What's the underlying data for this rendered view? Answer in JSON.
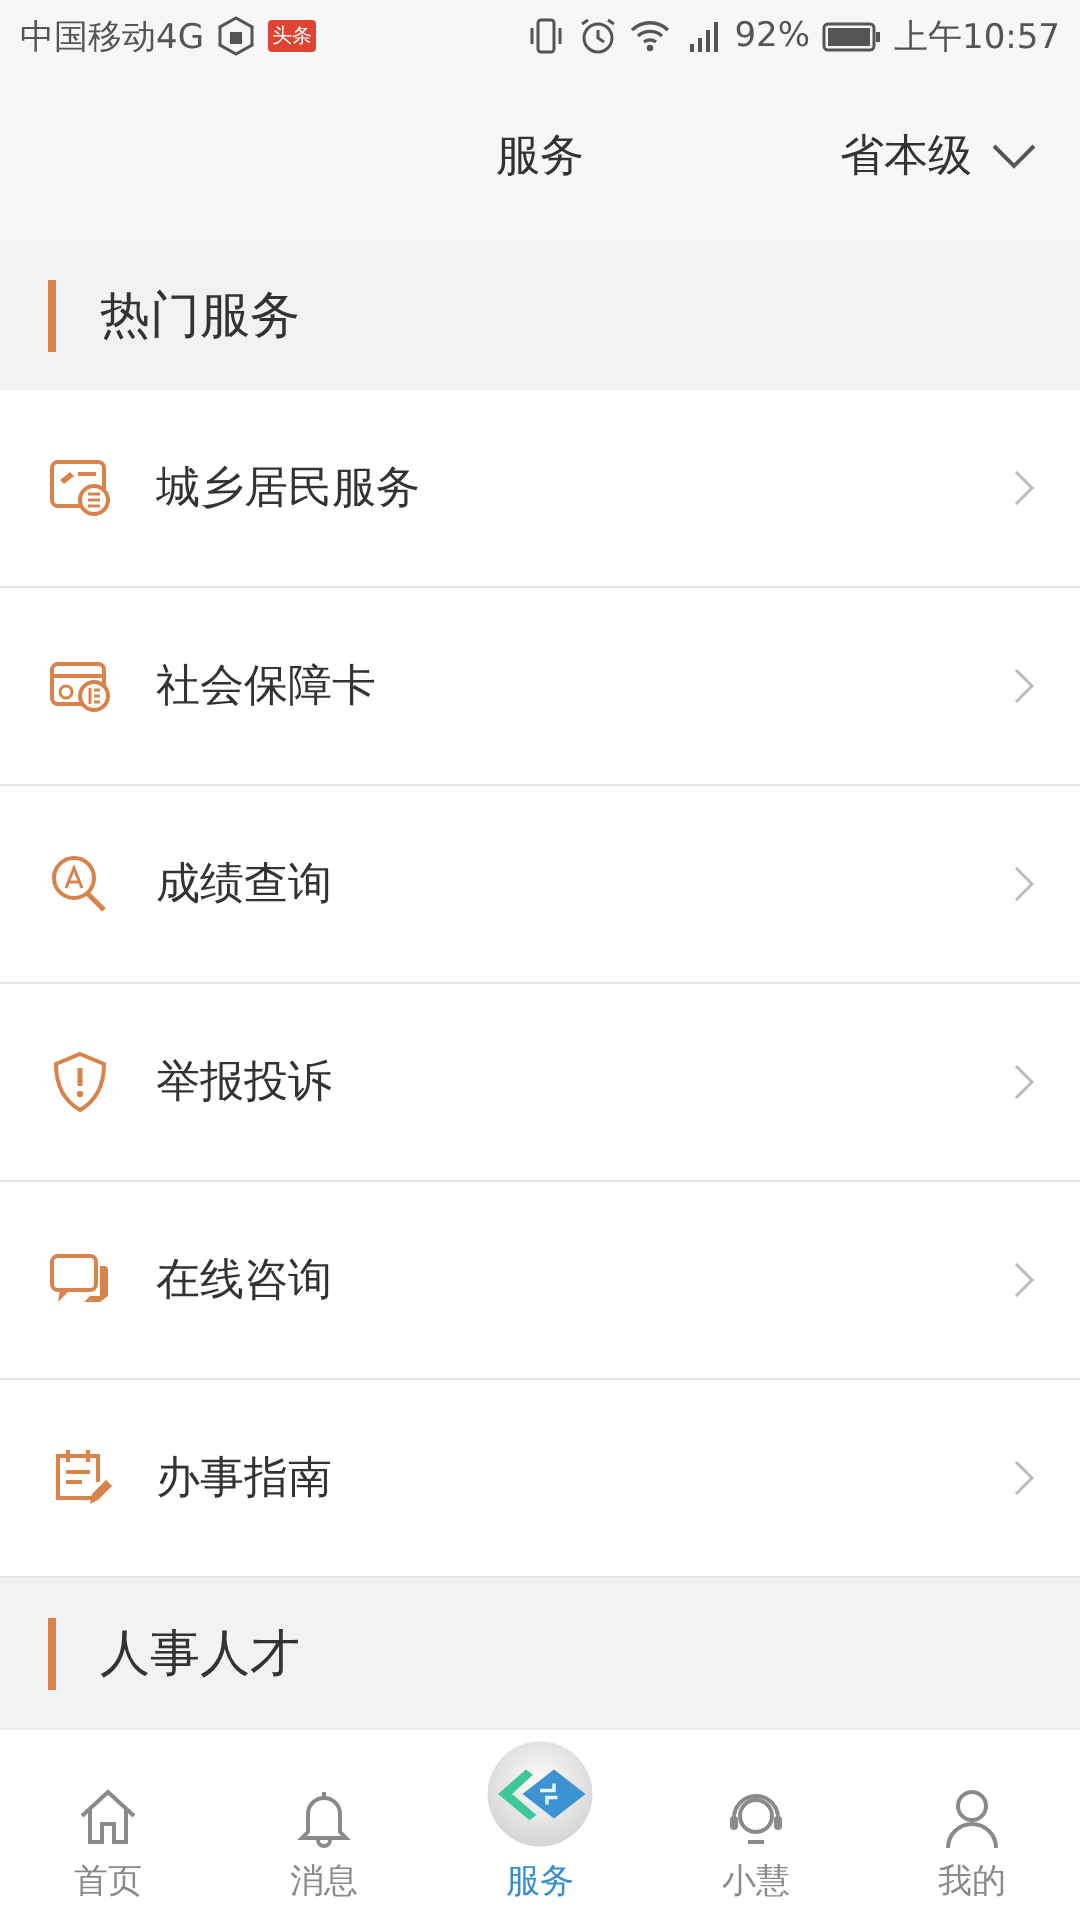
{
  "status_bar": {
    "carrier": "中国移动4G",
    "notification_badge": "头条",
    "battery": "92%",
    "time": "上午10:57"
  },
  "header": {
    "title": "服务",
    "region": "省本级"
  },
  "sections": [
    {
      "title": "热门服务",
      "items": [
        {
          "label": "城乡居民服务",
          "kind": "resident"
        },
        {
          "label": "社会保障卡",
          "kind": "card"
        },
        {
          "label": "成绩查询",
          "kind": "search"
        },
        {
          "label": "举报投诉",
          "kind": "shield"
        },
        {
          "label": "在线咨询",
          "kind": "chat"
        },
        {
          "label": "办事指南",
          "kind": "guide"
        }
      ]
    },
    {
      "title": "人事人才"
    }
  ],
  "tabs": [
    {
      "label": "首页",
      "kind": "home",
      "selected": false
    },
    {
      "label": "消息",
      "kind": "bell",
      "selected": false
    },
    {
      "label": "服务",
      "kind": "service",
      "selected": true
    },
    {
      "label": "小慧",
      "kind": "headset",
      "selected": false
    },
    {
      "label": "我的",
      "kind": "person",
      "selected": false
    }
  ]
}
